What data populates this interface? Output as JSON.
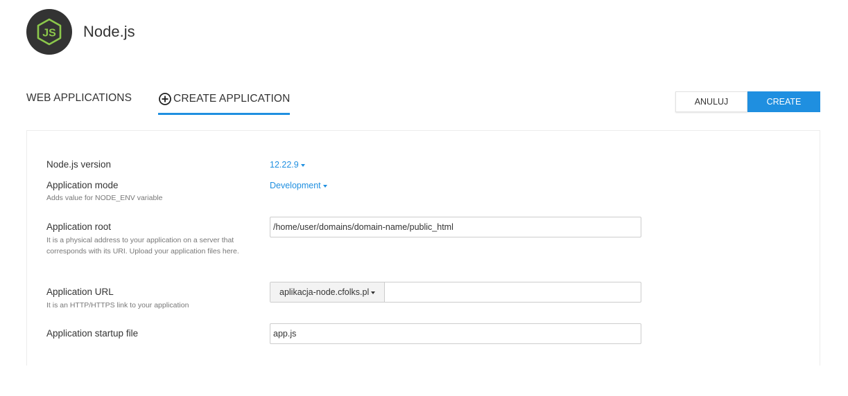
{
  "header": {
    "title": "Node.js",
    "logo_icon": "nodejs-icon"
  },
  "tabs": [
    {
      "label": "WEB APPLICATIONS",
      "active": false
    },
    {
      "label": "CREATE APPLICATION",
      "active": true,
      "icon": "plus-circle-icon"
    }
  ],
  "actions": {
    "cancel_label": "ANULUJ",
    "create_label": "CREATE"
  },
  "form": {
    "node_version": {
      "label": "Node.js version",
      "value": "12.22.9"
    },
    "app_mode": {
      "label": "Application mode",
      "hint": "Adds value for NODE_ENV variable",
      "value": "Development"
    },
    "app_root": {
      "label": "Application root",
      "hint": "It is a physical address to your application on a server that corresponds with its URI. Upload your application files here.",
      "value": "/home/user/domains/domain-name/public_html"
    },
    "app_url": {
      "label": "Application URL",
      "hint": "It is an HTTP/HTTPS link to your application",
      "domain": "aplikacja-node.cfolks.pl",
      "path": ""
    },
    "startup_file": {
      "label": "Application startup file",
      "value": "app.js"
    }
  },
  "colors": {
    "accent": "#1f8fe0",
    "logo_bg": "#333333",
    "logo_green": "#8cc84b"
  }
}
